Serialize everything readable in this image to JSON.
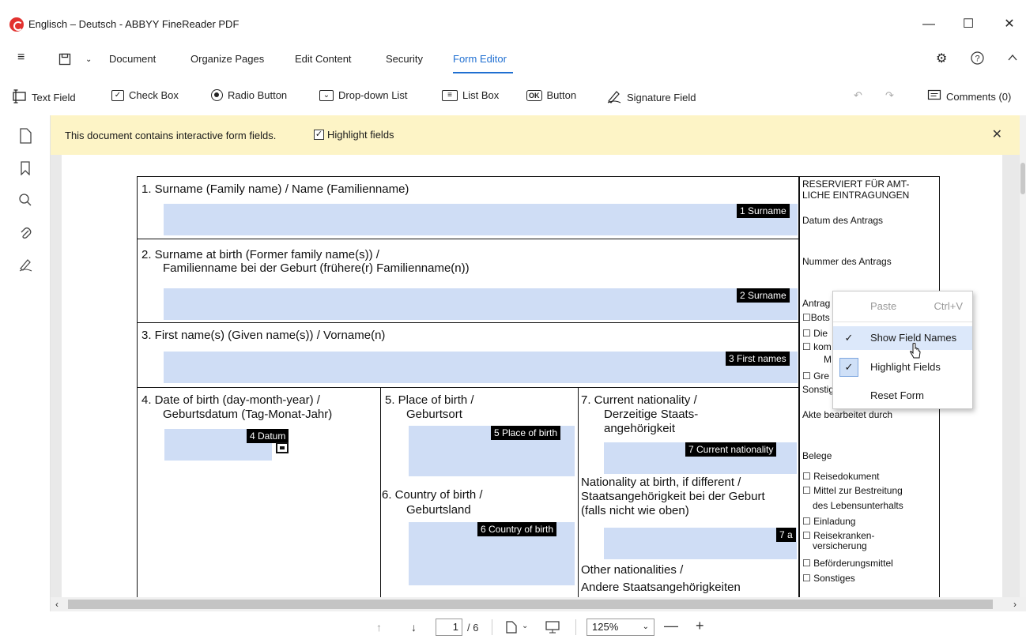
{
  "window": {
    "title": "Englisch – Deutsch - ABBYY FineReader PDF",
    "minimize": "—",
    "maximize": "☐",
    "close": "✕"
  },
  "menu": {
    "items": [
      "Document",
      "Organize Pages",
      "Edit Content",
      "Security",
      "Form Editor"
    ],
    "active": "Form Editor"
  },
  "toolbar": {
    "text_field": "Text Field",
    "check_box": "Check Box",
    "radio_button": "Radio Button",
    "dropdown_list": "Drop-down List",
    "list_box": "List Box",
    "button": "Button",
    "button_icon": "OK",
    "signature_field": "Signature Field",
    "comments": "Comments (0)"
  },
  "banner": {
    "text": "This document contains interactive form fields.",
    "highlight_label": "Highlight fields",
    "highlight_checked": true
  },
  "document": {
    "sections": {
      "s1": "1.  Surname (Family name) / Name (Familienname)",
      "s2a": "2.  Surname at birth (Former family name(s)) /",
      "s2b": "Familienname bei der Geburt (frühere(r) Familienname(n))",
      "s3": "3.  First name(s) (Given name(s)) / Vorname(n)",
      "s4a": "4.  Date of birth (day-month-year) /",
      "s4b": "Geburtsdatum (Tag-Monat-Jahr)",
      "s5a": "5.  Place of birth /",
      "s5b": "Geburtsort",
      "s6a": "6.  Country of birth /",
      "s6b": "Geburtsland",
      "s7a": "7.  Current nationality /",
      "s7b": "Derzeitige Staats-",
      "s7c": "angehörigkeit",
      "nat_birth_a": "Nationality at birth, if different /",
      "nat_birth_b": "Staatsangehörigkeit bei der Geburt",
      "nat_birth_c": "(falls nicht wie oben)",
      "other_nat_a": "Other nationalities /",
      "other_nat_b": "Andere Staatsangehörigkeiten"
    },
    "field_names": {
      "f1": "1 Surname",
      "f2": "2 Surname",
      "f3": "3 First names",
      "f4": "4 Datum",
      "f5": "5 Place of birth",
      "f6": "6 Country of birth",
      "f7": "7 Current nationality",
      "f7a": "7 a"
    },
    "reserved": {
      "header_a": "RESERVIERT FÜR AMT-",
      "header_b": "LICHE EINTRAGUNGEN",
      "datum": "Datum des Antrags",
      "nummer": "Nummer des Antrags",
      "antrag": "Antrag",
      "bots": "☐Bots",
      "die": "☐ Die",
      "kom": "☐ kom",
      "m": "M",
      "gre": "☐ Gre",
      "sonstig": "Sonstig",
      "akte": "Akte bearbeitet durch",
      "belege": "Belege",
      "reisedokument": "☐ Reisedokument",
      "mittel_a": "☐ Mittel zur Bestreitung",
      "mittel_b": "des Lebensunterhalts",
      "einladung": "☐ Einladung",
      "reisekranken_a": "☐ Reisekranken-",
      "reisekranken_b": "versicherung",
      "befoerderung": "☐ Beförderungsmittel",
      "sonstiges": "☐ Sonstiges"
    }
  },
  "context_menu": {
    "paste": "Paste",
    "paste_shortcut": "Ctrl+V",
    "show_field_names": "Show Field Names",
    "highlight_fields": "Highlight Fields",
    "reset_form": "Reset Form"
  },
  "status": {
    "page_current": "1",
    "page_total": "/ 6",
    "zoom": "125%"
  },
  "colors": {
    "accent": "#1f6fd1",
    "banner_bg": "#fdf4c6",
    "field_highlight": "#cfddf5",
    "field_name_bg": "#000000",
    "logo": "#e2322f"
  }
}
